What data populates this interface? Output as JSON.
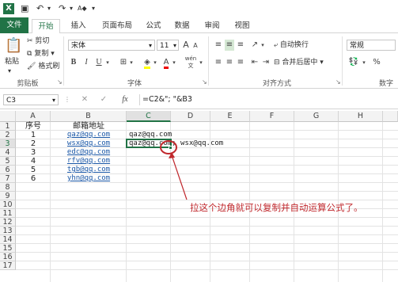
{
  "quick_access": {
    "save_icon": "save-icon",
    "undo_icon": "undo-icon",
    "redo_icon": "redo-icon"
  },
  "tabs": [
    {
      "label": "文件"
    },
    {
      "label": "开始"
    },
    {
      "label": "插入"
    },
    {
      "label": "页面布局"
    },
    {
      "label": "公式"
    },
    {
      "label": "数据"
    },
    {
      "label": "审阅"
    },
    {
      "label": "视图"
    }
  ],
  "ribbon": {
    "clipboard": {
      "paste": "粘贴",
      "cut": "剪切",
      "copy": "复制",
      "format_painter": "格式刷",
      "group": "剪贴板"
    },
    "font": {
      "name": "宋体",
      "size": "11",
      "group": "字体",
      "bold": "B",
      "italic": "I",
      "underline": "U",
      "grow": "A",
      "shrink": "A",
      "phonetic": "wén"
    },
    "alignment": {
      "wrap": "自动换行",
      "merge": "合并后居中",
      "group": "对齐方式"
    },
    "number": {
      "format": "常规",
      "group": "数字",
      "percent": "%"
    }
  },
  "formula_bar": {
    "name_box": "C3",
    "cancel": "✕",
    "enter": "✓",
    "fx": "fx",
    "formula": "=C2&\"; \"&B3"
  },
  "columns": [
    "A",
    "B",
    "C",
    "D",
    "E",
    "F",
    "G",
    "H"
  ],
  "rows": [
    "1",
    "2",
    "3",
    "4",
    "5",
    "6",
    "7",
    "8",
    "9",
    "10",
    "11",
    "12",
    "13",
    "14",
    "15",
    "16",
    "17"
  ],
  "cells": {
    "A1": "序号",
    "B1": "邮箱地址",
    "A2": "1",
    "B2": "qaz@qq.com",
    "C2": "qaz@qq.com",
    "A3": "2",
    "B3": "wsx@qq.com",
    "C3": "qaz@qq.com; wsx@qq.com",
    "A4": "3",
    "B4": "edc@qq.com",
    "A5": "4",
    "B5": "rfv@qq.com",
    "A6": "5",
    "B6": "tgb@qq.com",
    "A7": "6",
    "B7": "yhn@qq.com"
  },
  "annotation": {
    "text": "拉这个边角就可以复制并自动运算公式了。",
    "color": "#c0282d"
  },
  "accent_color": "#217346"
}
